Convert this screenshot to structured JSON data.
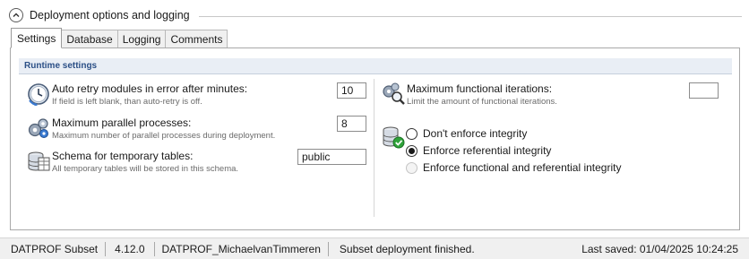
{
  "section": {
    "title": "Deployment options and logging"
  },
  "tabs": [
    {
      "label": "Settings",
      "active": true
    },
    {
      "label": "Database"
    },
    {
      "label": "Logging"
    },
    {
      "label": "Comments"
    }
  ],
  "runtime": {
    "header": "Runtime settings",
    "auto_retry": {
      "title": "Auto retry modules in error after minutes:",
      "desc": "If field is left blank, than auto-retry is off.",
      "value": "10"
    },
    "parallel": {
      "title": "Maximum parallel processes:",
      "desc": "Maximum number of parallel processes during deployment.",
      "value": "8"
    },
    "schema": {
      "title": "Schema for temporary tables:",
      "desc": "All temporary tables will be stored in this schema.",
      "value": "public"
    },
    "iterations": {
      "title": "Maximum functional iterations:",
      "desc": "Limit the amount of functional iterations.",
      "value": ""
    },
    "integrity": {
      "options": [
        {
          "label": "Don't enforce integrity",
          "checked": false,
          "disabled": false
        },
        {
          "label": "Enforce referential integrity",
          "checked": true,
          "disabled": false
        },
        {
          "label": "Enforce functional and referential integrity",
          "checked": false,
          "disabled": true
        }
      ]
    }
  },
  "status": {
    "app": "DATPROF Subset",
    "version": "4.12.0",
    "project": "DATPROF_MichaelvanTimmeren",
    "message": "Subset deployment finished.",
    "last_saved": "Last saved: 01/04/2025 10:24:25"
  },
  "colors": {
    "group_header_bg": "#e9eef5",
    "group_header_text": "#2b4f86",
    "status_bg": "#f0f0f0"
  }
}
